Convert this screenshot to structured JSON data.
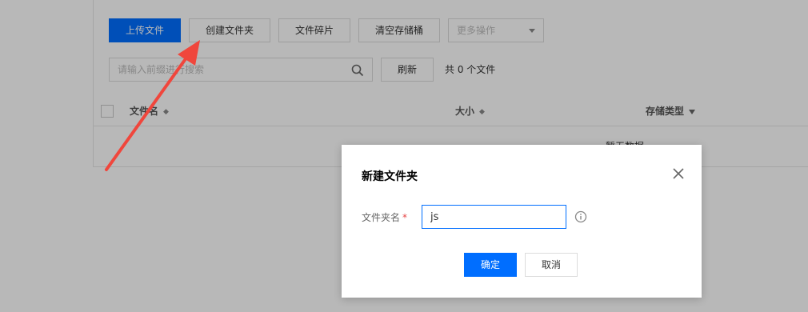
{
  "toolbar": {
    "upload_label": "上传文件",
    "create_folder_label": "创建文件夹",
    "fragments_label": "文件碎片",
    "clear_bucket_label": "清空存储桶",
    "more_actions_label": "更多操作"
  },
  "search": {
    "placeholder": "请输入前缀进行搜索",
    "refresh_label": "刷新",
    "count_text": "共 0 个文件"
  },
  "table": {
    "columns": [
      "文件名",
      "大小",
      "存储类型"
    ],
    "row_partial_text": "暂无数据"
  },
  "dialog": {
    "title": "新建文件夹",
    "field_label": "文件夹名",
    "required_mark": "*",
    "input_value": "js",
    "ok_label": "确定",
    "cancel_label": "取消"
  },
  "colors": {
    "primary": "#006eff",
    "annotation": "#f0463c",
    "required": "#e54545"
  }
}
